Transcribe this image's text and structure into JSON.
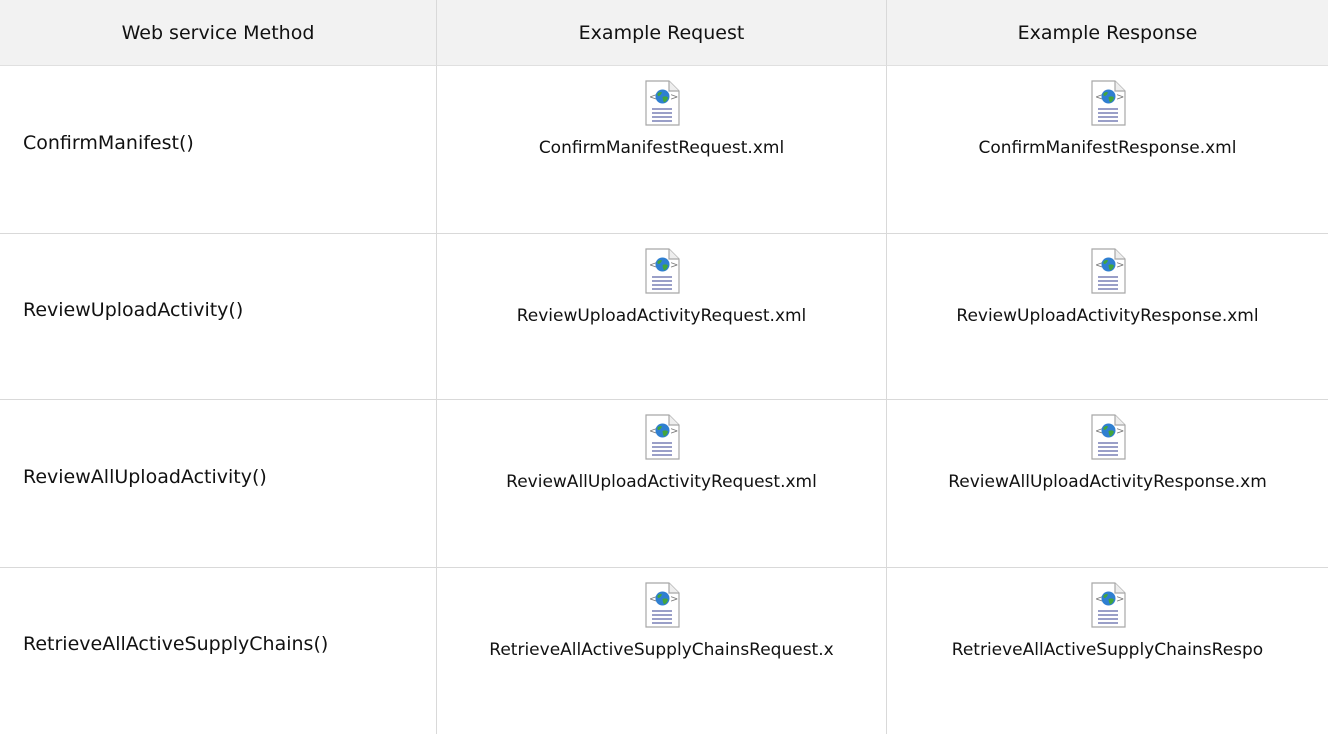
{
  "table": {
    "headers": [
      "Web service Method",
      "Example Request",
      "Example Response"
    ],
    "rows": [
      {
        "method": "ConfirmManifest()",
        "request": "ConfirmManifestRequest.xml",
        "response": "ConfirmManifestResponse.xml"
      },
      {
        "method": "ReviewUploadActivity()",
        "request": "ReviewUploadActivityRequest.xml",
        "response": "ReviewUploadActivityResponse.xml"
      },
      {
        "method": "ReviewAllUploadActivity()",
        "request": "ReviewAllUploadActivityRequest.xml",
        "response": "ReviewAllUploadActivityResponse.xm"
      },
      {
        "method": "RetrieveAllActiveSupplyChains()",
        "request": "RetrieveAllActiveSupplyChainsRequest.x",
        "response": "RetrieveAllActiveSupplyChainsRespo"
      }
    ]
  },
  "icons": {
    "attachment": "xml-file-icon"
  }
}
